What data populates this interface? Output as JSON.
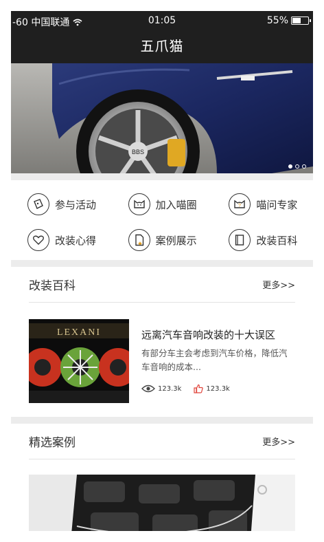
{
  "status_bar": {
    "carrier": "-60 中国联通",
    "time": "01:05",
    "battery": "55%",
    "battery_level": 0.55
  },
  "nav": {
    "title": "五爪猫"
  },
  "banner": {
    "dots": 3,
    "active_dot": 1
  },
  "menu": [
    {
      "label": "参与活动",
      "icon": "ticket-icon"
    },
    {
      "label": "加入喵圈",
      "icon": "cat-icon"
    },
    {
      "label": "喵问专家",
      "icon": "question-cat-icon"
    },
    {
      "label": "改装心得",
      "icon": "heart-icon"
    },
    {
      "label": "案例展示",
      "icon": "document-star-icon"
    },
    {
      "label": "改装百科",
      "icon": "book-icon"
    }
  ],
  "encyclopedia": {
    "title": "改装百科",
    "more": "更多>>",
    "article": {
      "title": "远离汽车音响改装的十大误区",
      "desc": "有部分车主会考虑到汽车价格，降低汽车音响的成本...",
      "views": "123.3k",
      "likes": "123.3k",
      "thumb_brand": "LEXANI"
    }
  },
  "cases": {
    "title": "精选案例",
    "more": "更多>>"
  }
}
